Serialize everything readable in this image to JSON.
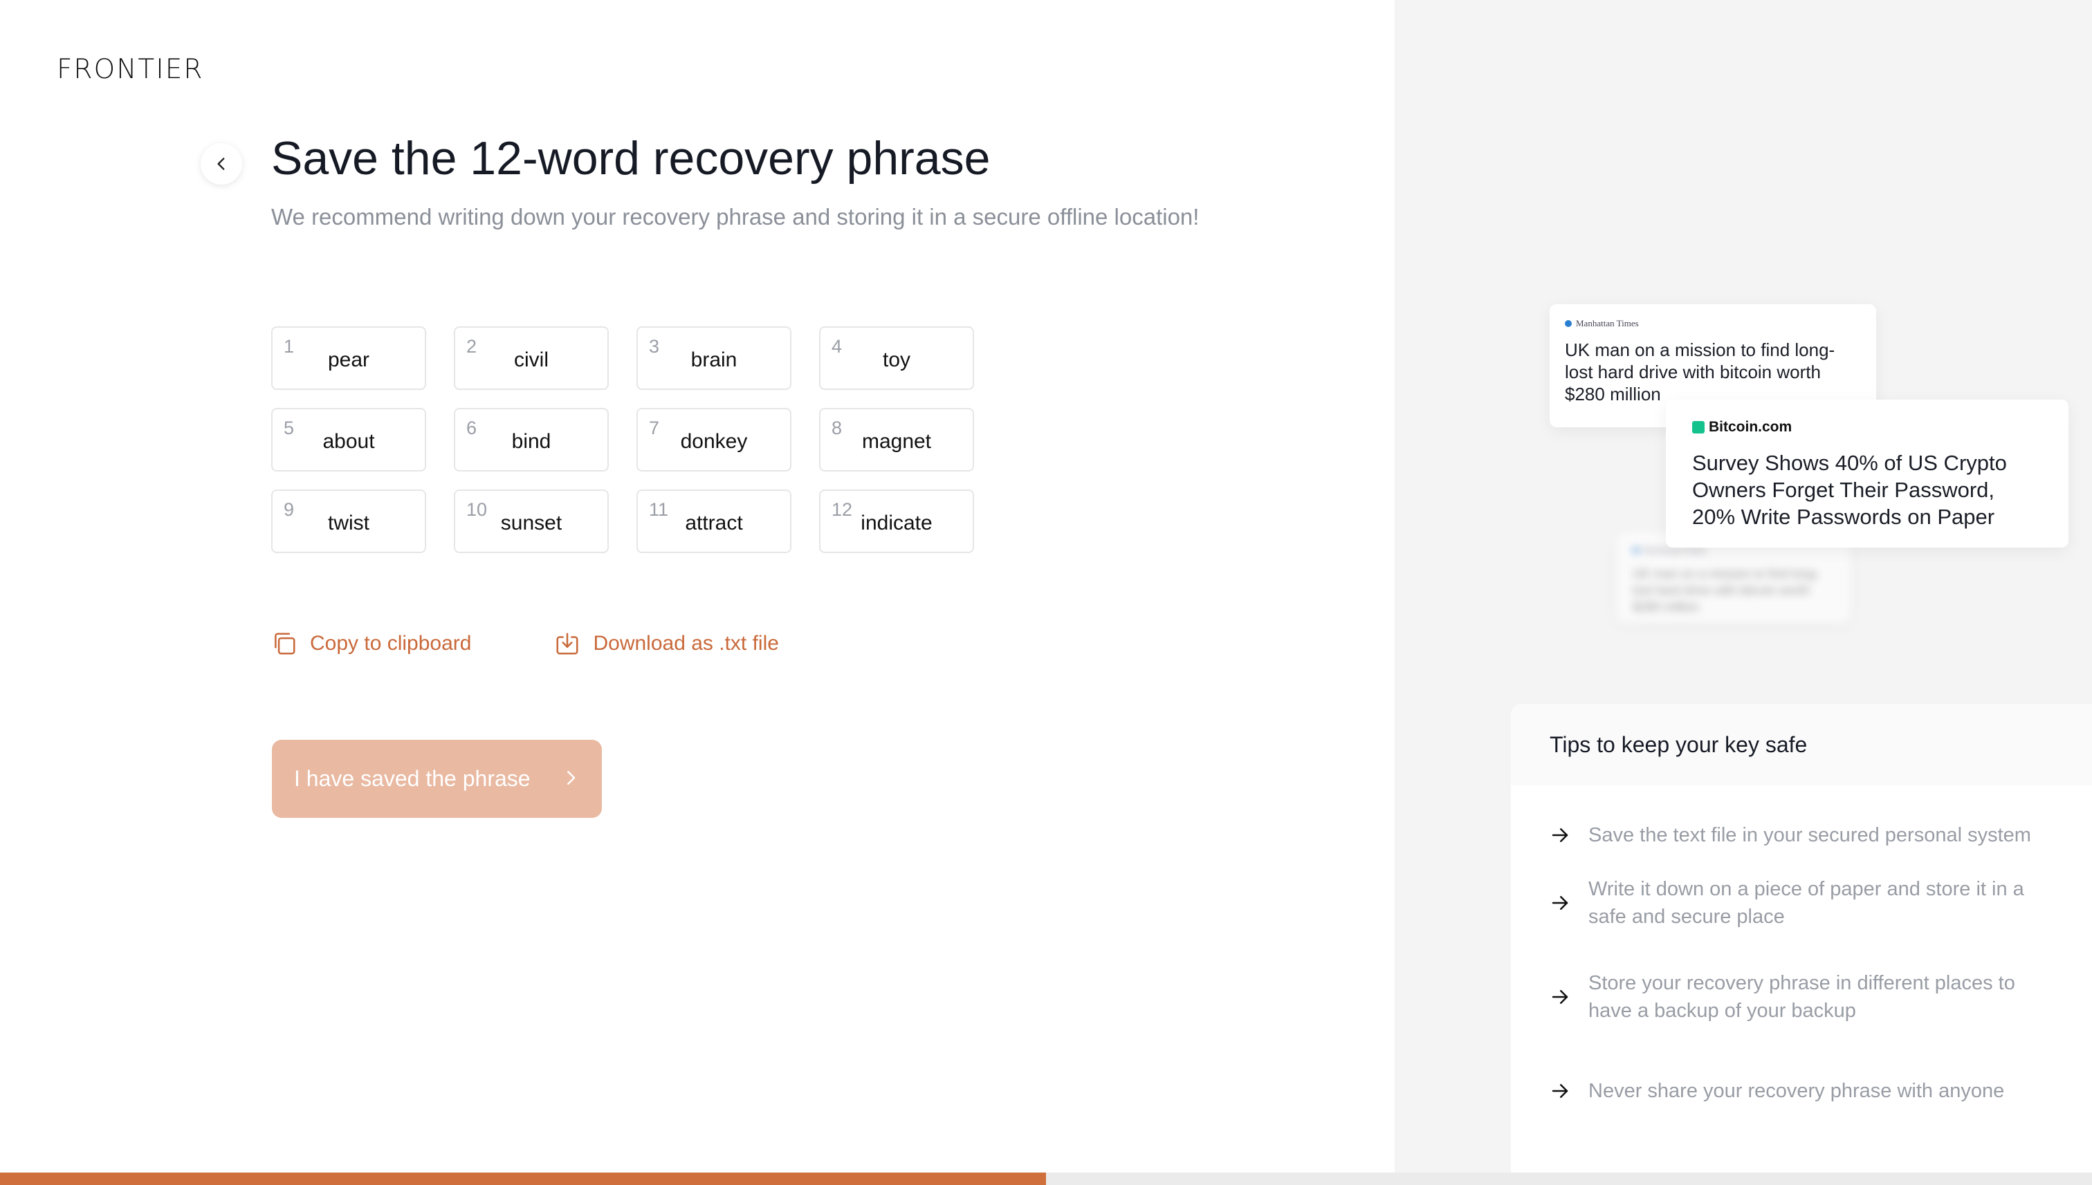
{
  "brand": {
    "logo_text": "FRONTIER"
  },
  "header": {
    "title": "Save the 12-word recovery phrase",
    "subtitle": "We recommend writing down your recovery phrase and storing it in a secure offline location!"
  },
  "phrase": {
    "words": [
      {
        "num": "1",
        "word": "pear"
      },
      {
        "num": "2",
        "word": "civil"
      },
      {
        "num": "3",
        "word": "brain"
      },
      {
        "num": "4",
        "word": "toy"
      },
      {
        "num": "5",
        "word": "about"
      },
      {
        "num": "6",
        "word": "bind"
      },
      {
        "num": "7",
        "word": "donkey"
      },
      {
        "num": "8",
        "word": "magnet"
      },
      {
        "num": "9",
        "word": "twist"
      },
      {
        "num": "10",
        "word": "sunset"
      },
      {
        "num": "11",
        "word": "attract"
      },
      {
        "num": "12",
        "word": "indicate"
      }
    ]
  },
  "actions": {
    "copy_label": "Copy to clipboard",
    "download_label": "Download as .txt file"
  },
  "primary_button": {
    "label": "I have saved the phrase",
    "state": "disabled"
  },
  "progress": {
    "fraction": 0.5,
    "fill_color": "#cf6f3b"
  },
  "news": {
    "card1": {
      "source": "Manhattan Times",
      "headline": "UK man on a mission to find long-lost hard drive with bitcoin worth $280 million"
    },
    "card2": {
      "source": "Bitcoin.com",
      "headline": "Survey Shows 40% of US Crypto Owners Forget Their Password, 20% Write Passwords on Paper"
    }
  },
  "tips": {
    "title": "Tips to keep your key safe",
    "items": [
      "Save the text file in your secured personal system",
      "Write it down on a piece of paper and store it in a safe and secure place",
      "Store your recovery phrase in different places to have a backup of your backup",
      "Never share your recovery phrase with anyone"
    ]
  },
  "colors": {
    "accent": "#c9693a",
    "button_disabled": "#e9b9a2",
    "right_pane_bg": "#f4f4f5"
  }
}
